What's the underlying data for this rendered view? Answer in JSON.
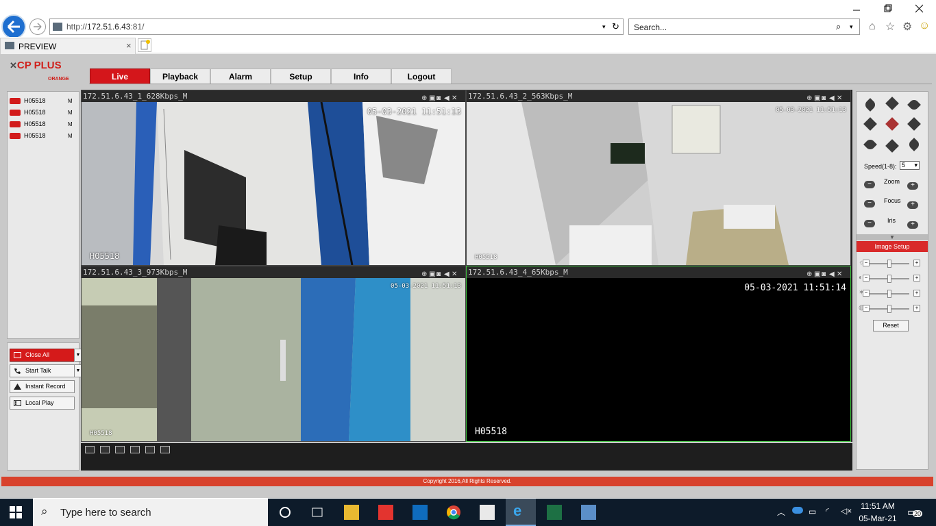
{
  "browser": {
    "url_prefix": "http://",
    "url_host": "172.51.6.43",
    "url_rest": ":81/",
    "search_placeholder": "Search...",
    "tab_title": "PREVIEW"
  },
  "app": {
    "logo_text": "CP PLUS",
    "logo_sub": "ORANGE",
    "nav": [
      "Live",
      "Playback",
      "Alarm",
      "Setup",
      "Info",
      "Logout"
    ],
    "active_nav": "Live",
    "cameras": [
      {
        "name": "H05518",
        "mode": "M"
      },
      {
        "name": "H05518",
        "mode": "M"
      },
      {
        "name": "H05518",
        "mode": "M"
      },
      {
        "name": "H05518",
        "mode": "M"
      }
    ],
    "buttons": {
      "close_all": "Close All",
      "start_talk": "Start Talk",
      "instant_record": "Instant Record",
      "local_play": "Local Play"
    },
    "streams": [
      {
        "header": "172.51.6.43_1_628Kbps_M",
        "timestamp": "05-03-2021 11:51:13",
        "label": "H05518"
      },
      {
        "header": "172.51.6.43_2_563Kbps_M",
        "timestamp": "05-03-2021 11:51:13",
        "label": "H05518"
      },
      {
        "header": "172.51.6.43_3_973Kbps_M",
        "timestamp": "05-03-2021 11:51:13",
        "label": "H05518"
      },
      {
        "header": "172.51.6.43_4_65Kbps_M",
        "timestamp": "05-03-2021 11:51:14",
        "label": "H05518"
      }
    ],
    "ptz": {
      "speed_label": "Speed(1-8):",
      "speed_value": "5",
      "zoom": "Zoom",
      "focus": "Focus",
      "iris": "Iris",
      "image_setup": "Image Setup",
      "reset": "Reset"
    },
    "footer": "Copyright 2016,All Rights Reserved."
  },
  "taskbar": {
    "search_placeholder": "Type here to search",
    "time": "11:51 AM",
    "date": "05-Mar-21",
    "notifications": "20"
  },
  "colors": {
    "brand_red": "#d4161b",
    "selected_border": "#3ec13e"
  }
}
